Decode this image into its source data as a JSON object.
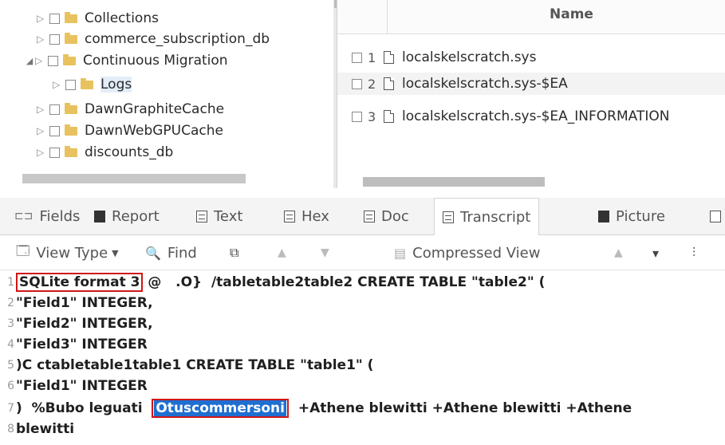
{
  "tree": {
    "items": [
      {
        "label": "Collections",
        "expanded": false
      },
      {
        "label": "commerce_subscription_db",
        "expanded": false
      },
      {
        "label": "Continuous Migration",
        "expanded": true
      },
      {
        "label": "Logs",
        "expanded": false
      },
      {
        "label": "DawnGraphiteCache",
        "expanded": false
      },
      {
        "label": "DawnWebGPUCache",
        "expanded": false
      },
      {
        "label": "discounts_db",
        "expanded": false
      }
    ]
  },
  "table": {
    "header_name": "Name",
    "rows": [
      {
        "num": "1",
        "name": "localskelscratch.sys"
      },
      {
        "num": "2",
        "name": "localskelscratch.sys-$EA"
      },
      {
        "num": "3",
        "name": "localskelscratch.sys-$EA_INFORMATION"
      }
    ]
  },
  "tabs": [
    {
      "label": "Fields",
      "icon": "fields-icon"
    },
    {
      "label": "Report",
      "icon": "report-icon"
    },
    {
      "label": "Text",
      "icon": "text-icon"
    },
    {
      "label": "Hex",
      "icon": "hex-icon"
    },
    {
      "label": "Doc",
      "icon": "doc-icon"
    },
    {
      "label": "Transcript",
      "icon": "transcript-icon",
      "active": true
    },
    {
      "label": "Picture",
      "icon": "picture-icon"
    }
  ],
  "toolbar": {
    "view_type": "View Type",
    "find": "Find",
    "compressed_view": "Compressed View"
  },
  "transcript": {
    "lines": [
      {
        "num": "1",
        "boxed": "SQLite format 3",
        "rest": " @   .O}  /tabletable2table2 CREATE TABLE \"table2\" ("
      },
      {
        "num": "2",
        "text": "\"Field1\" INTEGER,"
      },
      {
        "num": "3",
        "text": "\"Field2\" INTEGER,"
      },
      {
        "num": "4",
        "text": "\"Field3\" INTEGER"
      },
      {
        "num": "5",
        "text": ")C ctabletable1table1 CREATE TABLE \"table1\" ("
      },
      {
        "num": "6",
        "text": "\"Field1\" INTEGER"
      },
      {
        "num": "7",
        "pre": ")  %Bubo leguati  ",
        "highlight": "Otuscommersoni",
        "post": "  +Athene blewitti +Athene blewitti +Athene"
      },
      {
        "num": "8",
        "text": "blewitti"
      }
    ]
  },
  "colors": {
    "highlight_bg": "#1f6fd1",
    "annotation_box": "#d01616"
  }
}
